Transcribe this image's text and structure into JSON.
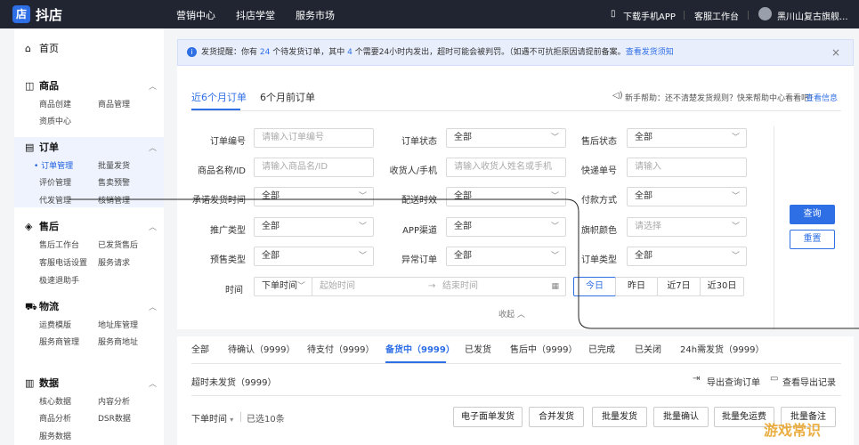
{
  "topbar": {
    "logo_glyph": "店",
    "brand": "抖店",
    "nav": [
      "营销中心",
      "抖店学堂",
      "服务市场"
    ],
    "download": "下载手机APP",
    "service": "客服工作台",
    "store": "黑川山复古旗舰..."
  },
  "sidebar": {
    "home": "首页",
    "goods": {
      "title": "商品",
      "items": [
        "商品创建",
        "商品管理",
        "资质中心"
      ]
    },
    "orders": {
      "title": "订单",
      "items": [
        "订单管理",
        "批量发货",
        "评价管理",
        "售卖预警",
        "代发管理",
        "核销管理"
      ]
    },
    "aftersale": {
      "title": "售后",
      "items": [
        "售后工作台",
        "已发货售后",
        "客服电话设置",
        "服务请求",
        "极速退助手"
      ]
    },
    "logistics": {
      "title": "物流",
      "items": [
        "运费模版",
        "地址库管理",
        "服务商管理",
        "服务商地址"
      ]
    },
    "data": {
      "title": "数据",
      "items": [
        "核心数据",
        "内容分析",
        "商品分析",
        "DSR数据",
        "服务数据"
      ]
    }
  },
  "notice": {
    "prefix": "发货提醒：你有",
    "pending": "24",
    "mid": "个待发货订单，其中",
    "urgent": "4",
    "suffix": "个需要24小时内发出，超时可能会被判罚。（如遇不可抗拒原因请提前备案。",
    "link": "查看发货须知",
    "close": "×"
  },
  "period_tabs": [
    "近6个月订单",
    "6个月前订单"
  ],
  "help": {
    "text": "新手帮助：还不清楚发货规则？快来帮助中心看看吧！",
    "link": "查看信息"
  },
  "filters": {
    "order_no": {
      "label": "订单编号",
      "placeholder": "请输入订单编号"
    },
    "order_status": {
      "label": "订单状态",
      "value": "全部"
    },
    "after_status": {
      "label": "售后状态",
      "value": "全部"
    },
    "goods": {
      "label": "商品名称/ID",
      "placeholder": "请输入商品名/ID"
    },
    "receiver": {
      "label": "收货人/手机",
      "placeholder": "请输入收货人姓名或手机"
    },
    "express": {
      "label": "快递单号",
      "placeholder": "请输入"
    },
    "promise": {
      "label": "承诺发货时间",
      "value": "全部"
    },
    "delivery": {
      "label": "配送时效",
      "value": "全部"
    },
    "pay": {
      "label": "付款方式",
      "value": "全部"
    },
    "promo": {
      "label": "推广类型",
      "value": "全部"
    },
    "app": {
      "label": "APP渠道",
      "value": "全部"
    },
    "flag": {
      "label": "旗帜颜色",
      "placeholder": "请选择"
    },
    "presale": {
      "label": "预售类型",
      "value": "全部"
    },
    "abnormal": {
      "label": "异常订单",
      "value": "全部"
    },
    "order_type": {
      "label": "订单类型",
      "value": "全部"
    },
    "time": {
      "label": "时间",
      "type": "下单时间",
      "start": "起始时间",
      "sep": "→",
      "end": "结束时间"
    },
    "quick": [
      "今日",
      "昨日",
      "近7日",
      "近30日"
    ]
  },
  "buttons": {
    "query": "查询",
    "reset": "重置",
    "collapse": "收起"
  },
  "status_tabs": [
    "全部",
    "待确认（9999）",
    "待支付（9999）",
    "备货中（9999）",
    "已发货",
    "售后中（9999）",
    "已完成",
    "已关闭",
    "24h需发货（9999）"
  ],
  "overdue": "超时未发货（9999）",
  "export": {
    "query": "导出查询订单",
    "records": "查看导出记录"
  },
  "list": {
    "sort": "下单时间",
    "selected": "已选10条"
  },
  "actions": [
    "电子面单发货",
    "合并发货",
    "批量发货",
    "批量确认",
    "批量免运费",
    "批量备注"
  ],
  "watermark": "游戏常识",
  "colors": {
    "accent": "#2f6fe6",
    "topbar": "#202531"
  }
}
